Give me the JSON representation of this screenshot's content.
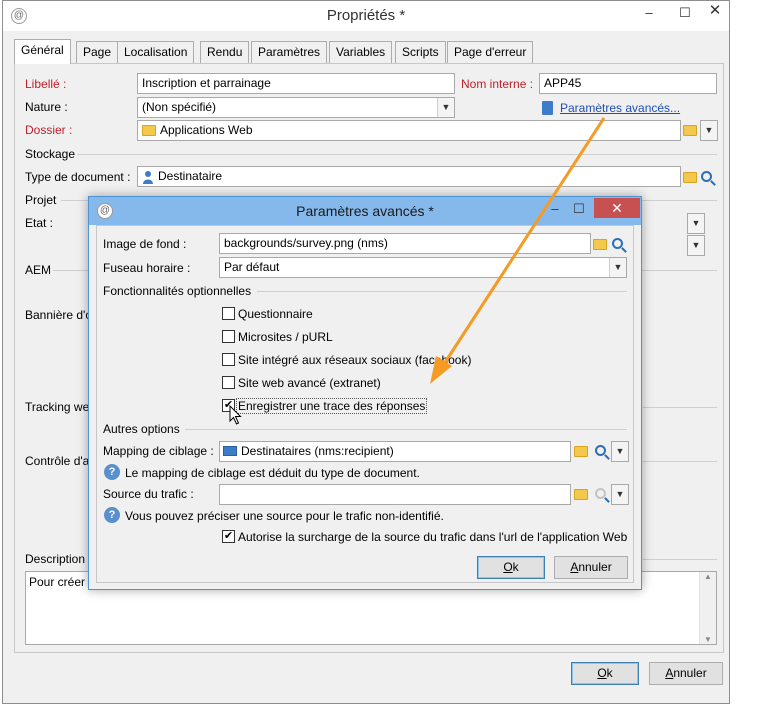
{
  "window": {
    "title": "Propriétés *",
    "app_icon": "adobe-campaign-icon",
    "tabs": [
      "Général",
      "Page",
      "Localisation",
      "Rendu",
      "Paramètres",
      "Variables",
      "Scripts",
      "Page d'erreur"
    ],
    "active_tab": "Général"
  },
  "form": {
    "libelle_label": "Libellé :",
    "libelle_value": "Inscription et parrainage",
    "nom_interne_label": "Nom interne :",
    "nom_interne_value": "APP45",
    "nature_label": "Nature :",
    "nature_value": "(Non spécifié)",
    "params_link": "Paramètres avancés...",
    "dossier_label": "Dossier :",
    "dossier_value": "Applications Web",
    "stockage_label": "Stockage",
    "type_doc_label": "Type de document :",
    "type_doc_value": "Destinataire",
    "projet_label": "Projet",
    "etat_label": "Etat :",
    "aem_label": "AEM",
    "banniere_label": "Bannière d'o",
    "tracking_label": "Tracking we",
    "controle_label": "Contrôle d'a",
    "description_label": "Description",
    "description_value": "Pour créer u"
  },
  "footer": {
    "ok_label": "Ok",
    "ok_mnemonic": "O",
    "ok_rest": "k",
    "cancel_label": "Annuler",
    "cancel_mnemonic": "A",
    "cancel_rest": "nnuler"
  },
  "dialog": {
    "title": "Paramètres avancés *",
    "image_fond_label": "Image de fond :",
    "image_fond_value": "backgrounds/survey.png (nms)",
    "fuseau_label": "Fuseau horaire :",
    "fuseau_value": "Par défaut",
    "fonctionnalites_label": "Fonctionnalités optionnelles",
    "features": [
      {
        "label": "Questionnaire",
        "checked": false
      },
      {
        "label": "Microsites / pURL",
        "checked": false
      },
      {
        "label": "Site intégré aux réseaux sociaux (facebook)",
        "checked": false
      },
      {
        "label": "Site web avancé (extranet)",
        "checked": false
      },
      {
        "label": "Enregistrer une trace des réponses",
        "checked": true
      }
    ],
    "autres_label": "Autres options",
    "mapping_label": "Mapping de ciblage :",
    "mapping_value": "Destinataires (nms:recipient)",
    "mapping_info": "Le mapping de ciblage est déduit du type de document.",
    "source_label": "Source du trafic :",
    "source_value": "",
    "source_info": "Vous pouvez préciser une source pour le trafic non-identifié.",
    "surcharge_label": "Autorise la surcharge de la source du trafic dans l'url de l'application Web",
    "surcharge_checked": true,
    "ok_label": "Ok",
    "ok_mnemonic": "O",
    "ok_rest": "k",
    "cancel_label": "Annuler",
    "cancel_mnemonic": "A",
    "cancel_rest": "nnuler"
  },
  "colors": {
    "required_label": "#c0202a",
    "link": "#1f4fb5",
    "dialog_titlebar": "#85b9ec",
    "annotation_arrow": "#f59a23",
    "close_button": "#c75050"
  }
}
